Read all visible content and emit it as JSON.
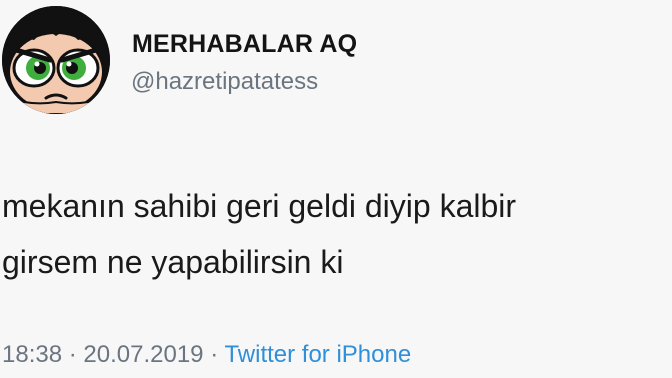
{
  "user": {
    "display_name": "MERHABALAR AQ",
    "handle": "@hazretipatatess",
    "avatar_icon": "buttercup-avatar-icon"
  },
  "tweet": {
    "lines": [
      "mekanın sahibi geri geldi diyip kalbir",
      "girsem ne yapabilirsin ki"
    ]
  },
  "meta": {
    "time": "18:38",
    "separator": "·",
    "date": "20.07.2019",
    "source": "Twitter for iPhone"
  },
  "colors": {
    "background": "#f7f7f8",
    "source_link": "#2f8fd8",
    "muted": "#6b7580"
  }
}
